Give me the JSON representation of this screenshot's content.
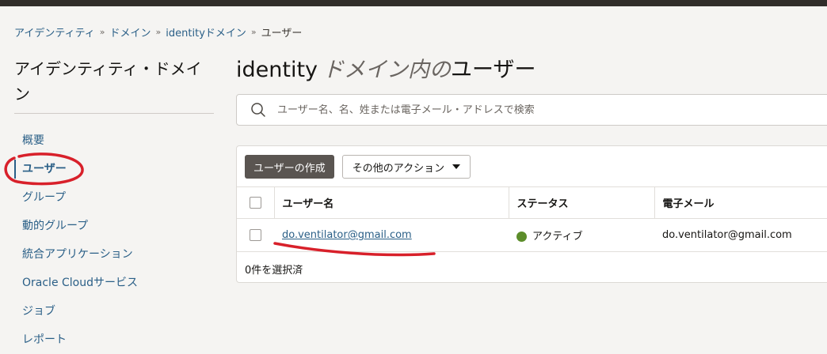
{
  "breadcrumb": [
    {
      "label": "アイデンティティ"
    },
    {
      "label": "ドメイン"
    },
    {
      "label": "identityドメイン"
    },
    {
      "label": "ユーザー"
    }
  ],
  "sidebar": {
    "title": "アイデンティティ・ドメイン",
    "items": [
      {
        "label": "概要"
      },
      {
        "label": "ユーザー",
        "active": true
      },
      {
        "label": "グループ"
      },
      {
        "label": "動的グループ"
      },
      {
        "label": "統合アプリケーション"
      },
      {
        "label": "Oracle Cloudサービス"
      },
      {
        "label": "ジョブ"
      },
      {
        "label": "レポート"
      }
    ]
  },
  "main": {
    "title_prefix": "identity",
    "title_italic": "ドメイン内の",
    "title_suffix": "ユーザー",
    "search_placeholder": "ユーザー名、名、姓または電子メール・アドレスで検索",
    "create_button": "ユーザーの作成",
    "more_actions": "その他のアクション",
    "table": {
      "headers": [
        "ユーザー名",
        "ステータス",
        "電子メール"
      ],
      "rows": [
        {
          "username": "do.ventilator@gmail.com",
          "status": "アクティブ",
          "email": "do.ventilator@gmail.com"
        }
      ]
    },
    "selected_count": "0件を選択済"
  },
  "colors": {
    "link": "#2a5f87",
    "status_active": "#5c8d2a",
    "annotation": "#d8202a"
  },
  "icons": {
    "search": "search-icon",
    "caret": "chevron-down-icon"
  }
}
